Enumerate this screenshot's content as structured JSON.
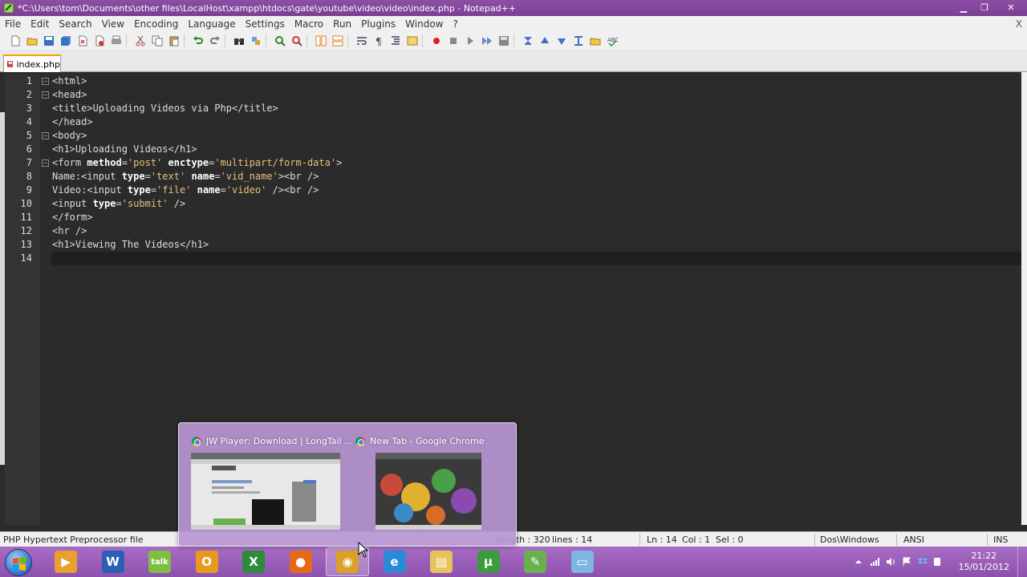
{
  "window": {
    "title": "*C:\\Users\\tom\\Documents\\other files\\LocalHost\\xampp\\htdocs\\gate\\youtube\\video\\video\\index.php - Notepad++"
  },
  "menu": [
    "File",
    "Edit",
    "Search",
    "View",
    "Encoding",
    "Language",
    "Settings",
    "Macro",
    "Run",
    "Plugins",
    "Window",
    "?"
  ],
  "menu_close": "X",
  "tab": {
    "label": "index.php"
  },
  "editor": {
    "lines": [
      {
        "n": "1",
        "html": "<html>"
      },
      {
        "n": "2",
        "html": "<head>"
      },
      {
        "n": "3",
        "html": "<title>Uploading Videos via Php</title>"
      },
      {
        "n": "4",
        "html": "</head>"
      },
      {
        "n": "5",
        "html": "<body>"
      },
      {
        "n": "6",
        "html": "<h1>Uploading Videos</h1>"
      },
      {
        "n": "7",
        "html": "<form method='post' enctype='multipart/form-data'>"
      },
      {
        "n": "8",
        "html": "Name:<input type='text' name='vid_name'><br />"
      },
      {
        "n": "9",
        "html": "Video:<input type='file' name='video' /><br />"
      },
      {
        "n": "10",
        "html": "<input type='submit' />"
      },
      {
        "n": "11",
        "html": "</form>"
      },
      {
        "n": "12",
        "html": "<hr />"
      },
      {
        "n": "13",
        "html": "<h1>Viewing The Videos</h1>"
      },
      {
        "n": "14",
        "html": ""
      }
    ]
  },
  "status": {
    "filetype": "PHP Hypertext Preprocessor file",
    "length": "length : 320",
    "lines": "lines : 14",
    "ln": "Ln : 14",
    "col": "Col : 1",
    "sel": "Sel : 0",
    "eol": "Dos\\Windows",
    "encoding": "ANSI",
    "mode": "INS"
  },
  "preview": {
    "items": [
      {
        "title": "JW Player: Download | LongTail ..."
      },
      {
        "title": "New Tab - Google Chrome"
      }
    ]
  },
  "taskbar": {
    "apps": [
      {
        "icon": "media-player-icon",
        "color": "#e8a030",
        "glyph": "▶"
      },
      {
        "icon": "word-icon",
        "color": "#2b5fb4",
        "glyph": "W"
      },
      {
        "icon": "google-talk-icon",
        "color": "#7fbf3f",
        "glyph": "talk"
      },
      {
        "icon": "outlook-icon",
        "color": "#e89a1e",
        "glyph": "O"
      },
      {
        "icon": "excel-icon",
        "color": "#2f8a3a",
        "glyph": "X"
      },
      {
        "icon": "firefox-icon",
        "color": "#e56a18",
        "glyph": "●"
      },
      {
        "icon": "chrome-icon",
        "color": "#d9a12a",
        "glyph": "◉"
      },
      {
        "icon": "internet-explorer-icon",
        "color": "#2a8ad8",
        "glyph": "e"
      },
      {
        "icon": "file-explorer-icon",
        "color": "#e8c25a",
        "glyph": "▤"
      },
      {
        "icon": "utorrent-icon",
        "color": "#3a9c3a",
        "glyph": "µ"
      },
      {
        "icon": "notepad-plus-plus-icon",
        "color": "#6ab04c",
        "glyph": "✎"
      },
      {
        "icon": "notepad-icon",
        "color": "#7fb6e0",
        "glyph": "▭"
      }
    ],
    "clock_time": "21:22",
    "clock_date": "15/01/2012"
  }
}
